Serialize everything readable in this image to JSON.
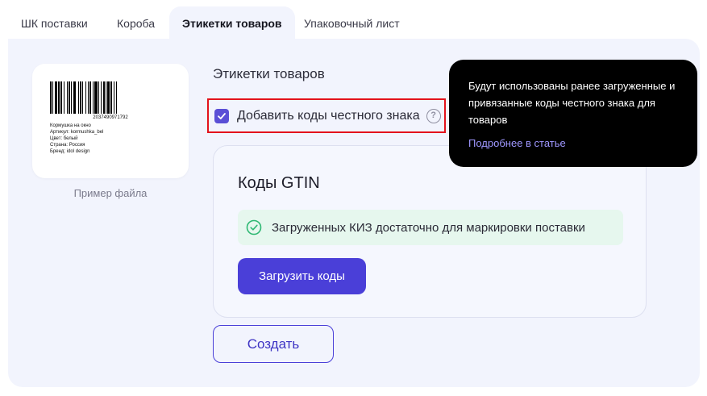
{
  "tabs": [
    {
      "label": "ШК поставки"
    },
    {
      "label": "Короба"
    },
    {
      "label": "Этикетки товаров"
    },
    {
      "label": "Упаковочный лист"
    }
  ],
  "sample": {
    "barcode_number": "2037490971792",
    "lines": [
      "Кормушка на окно",
      "Артикул: kormushka_bel",
      "Цвет: белый",
      "Страна: Россия",
      "Бренд: idol design"
    ],
    "caption": "Пример файла"
  },
  "section": {
    "title": "Этикетки товаров",
    "checkbox_label": "Добавить коды честного знака",
    "checkbox_checked": true,
    "help_symbol": "?"
  },
  "gtin": {
    "title": "Коды GTIN",
    "alert": "Загруженных КИЗ достаточно для маркировки поставки",
    "upload_label": "Загрузить коды"
  },
  "create_label": "Создать",
  "tooltip": {
    "text": "Будут использованы ранее загруженные и привязанные коды честного знака для товаров",
    "link": "Подробнее в статье"
  },
  "colors": {
    "accent": "#4a3fd8",
    "panel_bg": "#f2f4fd",
    "success_bg": "#e6f7ee",
    "success_icon": "#2fb873",
    "highlight_border": "#e3131c"
  }
}
